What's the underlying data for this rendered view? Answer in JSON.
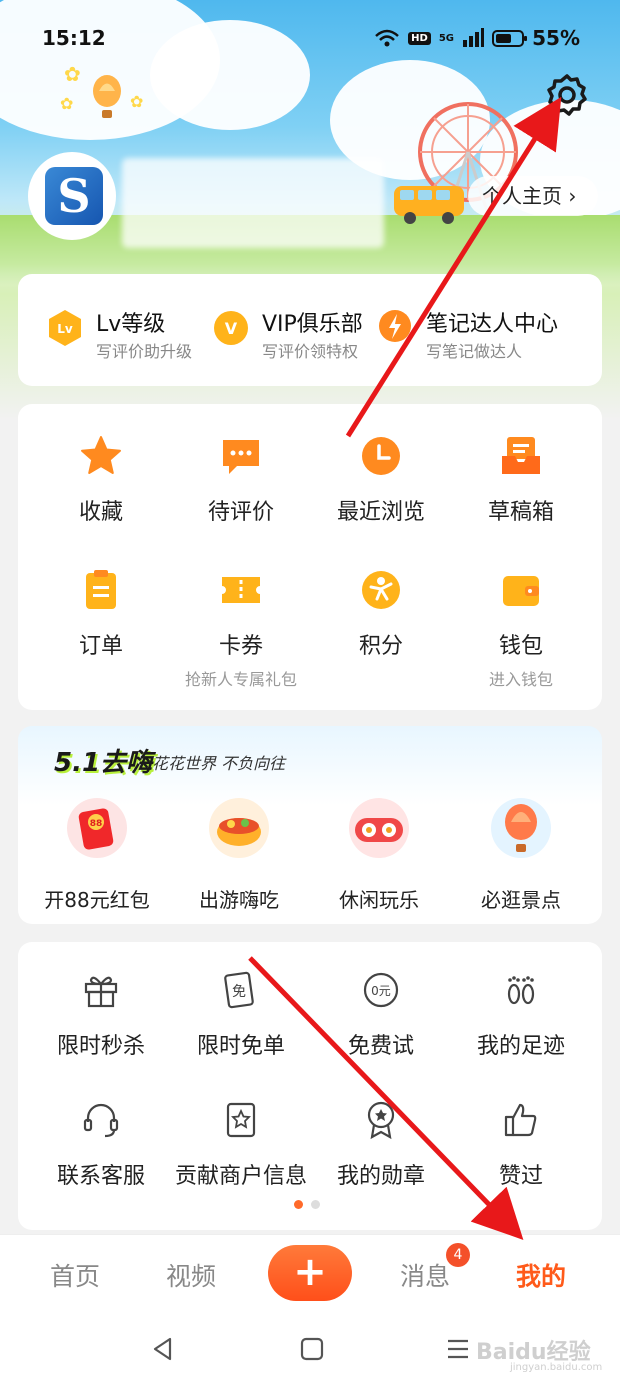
{
  "status_bar": {
    "time": "15:12",
    "network": "5G",
    "hd": "HD",
    "battery": "55%"
  },
  "profile": {
    "home_button": "个人主页 ›"
  },
  "level_row": [
    {
      "icon": "lv-icon",
      "badge_text": "Lv",
      "title": "Lv等级",
      "subtitle": "写评价助升级"
    },
    {
      "icon": "vip-icon",
      "badge_text": "V",
      "title": "VIP俱乐部",
      "subtitle": "写评价领特权"
    },
    {
      "icon": "note-expert-icon",
      "badge_text": "",
      "title": "笔记达人中心",
      "subtitle": "写笔记做达人"
    }
  ],
  "main_grid": [
    {
      "icon": "star-icon",
      "label": "收藏",
      "sub": ""
    },
    {
      "icon": "comment-icon",
      "label": "待评价",
      "sub": ""
    },
    {
      "icon": "clock-icon",
      "label": "最近浏览",
      "sub": ""
    },
    {
      "icon": "draft-box-icon",
      "label": "草稿箱",
      "sub": ""
    },
    {
      "icon": "order-icon",
      "label": "订单",
      "sub": ""
    },
    {
      "icon": "coupon-icon",
      "label": "卡券",
      "sub": "抢新人专属礼包"
    },
    {
      "icon": "points-icon",
      "label": "积分",
      "sub": ""
    },
    {
      "icon": "wallet-icon",
      "label": "钱包",
      "sub": "进入钱包"
    }
  ],
  "promo": {
    "title": "5.1去嗨",
    "subtitle": "花花世界 不负向往",
    "items": [
      {
        "icon": "red-packet-icon",
        "label": "开88元红包",
        "badge": "88"
      },
      {
        "icon": "food-icon",
        "label": "出游嗨吃"
      },
      {
        "icon": "game-icon",
        "label": "休闲玩乐"
      },
      {
        "icon": "balloon-icon",
        "label": "必逛景点"
      }
    ]
  },
  "tools": [
    {
      "icon": "gift-icon",
      "label": "限时秒杀"
    },
    {
      "icon": "free-ticket-icon",
      "label": "限时免单",
      "glyph": "免"
    },
    {
      "icon": "free-trial-icon",
      "label": "免费试",
      "glyph": "0元"
    },
    {
      "icon": "footprint-icon",
      "label": "我的足迹"
    },
    {
      "icon": "headset-icon",
      "label": "联系客服"
    },
    {
      "icon": "shop-info-icon",
      "label": "贡献商户信息"
    },
    {
      "icon": "medal-icon",
      "label": "我的勋章"
    },
    {
      "icon": "thumbs-up-icon",
      "label": "赞过"
    }
  ],
  "tabbar": {
    "home": "首页",
    "video": "视频",
    "plus": "+",
    "messages": "消息",
    "messages_badge": "4",
    "mine": "我的"
  },
  "watermark": {
    "text": "Baidu经验",
    "sub": "jingyan.baidu.com"
  },
  "colors": {
    "accent": "#ff5a1a",
    "icon_orange": "#ff8a1f",
    "icon_yellow": "#ffb31a",
    "arrow_red": "#e8181a"
  }
}
